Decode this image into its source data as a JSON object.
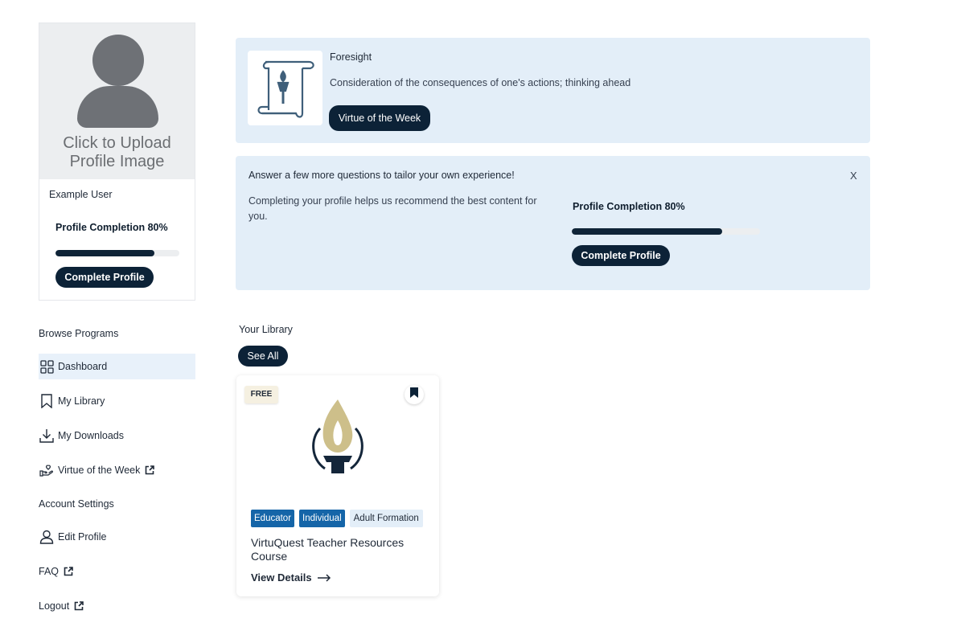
{
  "profile": {
    "upload_text": "Click to Upload Profile Image",
    "user_name": "Example User",
    "completion_label": "Profile Completion 80%",
    "completion_fraction": 0.8,
    "complete_button": "Complete Profile"
  },
  "nav": {
    "browse_heading": "Browse Programs",
    "dashboard": "Dashboard",
    "my_library": "My Library",
    "my_downloads": "My Downloads",
    "virtue_week": "Virtue of the Week",
    "account_heading": "Account Settings",
    "edit_profile": "Edit Profile",
    "faq": "FAQ",
    "logout": "Logout"
  },
  "virtue": {
    "title": "Foresight",
    "description": "Consideration of the consequences of one's actions; thinking ahead",
    "button": "Virtue of the Week"
  },
  "complete_banner": {
    "title": "Answer a few more questions to tailor your own experience!",
    "description": "Completing your profile helps us recommend the best content for you.",
    "close": "X",
    "completion_label": "Profile Completion 80%",
    "completion_fraction": 0.8,
    "button": "Complete Profile"
  },
  "library": {
    "title": "Your Library",
    "see_all": "See All",
    "card": {
      "badge": "FREE",
      "tags": [
        "Educator",
        "Individual",
        "Adult Formation"
      ],
      "title": "VirtuQuest Teacher Resources Course",
      "view_details": "View Details"
    }
  },
  "colors": {
    "navy": "#0c2237",
    "banner_bg": "#e3eef8",
    "tag_blue": "#1565a8",
    "gold": "#cdbf8a"
  }
}
